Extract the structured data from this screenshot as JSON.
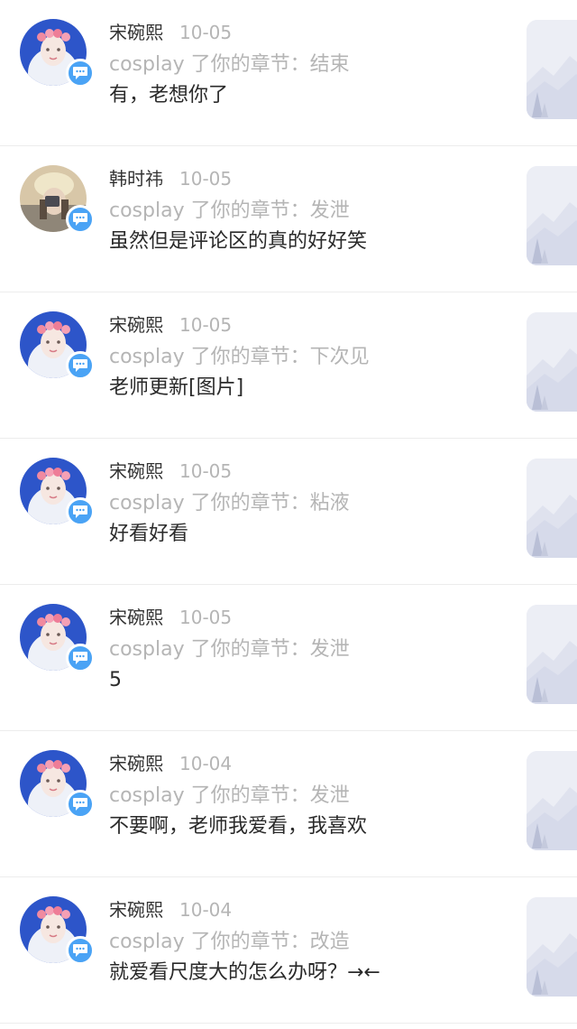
{
  "notifications": [
    {
      "name": "宋碗熙",
      "date": "10-05",
      "action_prefix": "cosplay 了你的章节：",
      "chapter": "结束",
      "comment": "有，老想你了",
      "avatar": "girl-flower-crown-avatar"
    },
    {
      "name": "韩时祎",
      "date": "10-05",
      "action_prefix": "cosplay 了你的章节：",
      "chapter": "发泄",
      "comment": "虽然但是评论区的真的好好笑",
      "avatar": "girl-hat-selfie-avatar"
    },
    {
      "name": "宋碗熙",
      "date": "10-05",
      "action_prefix": "cosplay 了你的章节：",
      "chapter": "下次见",
      "comment": "老师更新[图片]",
      "avatar": "girl-flower-crown-avatar"
    },
    {
      "name": "宋碗熙",
      "date": "10-05",
      "action_prefix": "cosplay 了你的章节：",
      "chapter": "粘液",
      "comment": "好看好看",
      "avatar": "girl-flower-crown-avatar"
    },
    {
      "name": "宋碗熙",
      "date": "10-05",
      "action_prefix": "cosplay 了你的章节：",
      "chapter": "发泄",
      "comment": "5",
      "avatar": "girl-flower-crown-avatar"
    },
    {
      "name": "宋碗熙",
      "date": "10-04",
      "action_prefix": "cosplay 了你的章节：",
      "chapter": "发泄",
      "comment": "不要啊，老师我爱看，我喜欢",
      "avatar": "girl-flower-crown-avatar"
    },
    {
      "name": "宋碗熙",
      "date": "10-04",
      "action_prefix": "cosplay 了你的章节：",
      "chapter": "改造",
      "comment": "就爱看尺度大的怎么办呀？→←",
      "avatar": "girl-flower-crown-avatar"
    }
  ],
  "colors": {
    "badge": "#4aa3f5",
    "avatar_blue": "#2d55c9",
    "text_primary": "#2a2a2a",
    "text_secondary": "#b5b5b5",
    "divider": "#ececec"
  },
  "icons": {
    "badge": "comment-bubble-icon",
    "thumbnail": "placeholder-landscape-icon"
  }
}
